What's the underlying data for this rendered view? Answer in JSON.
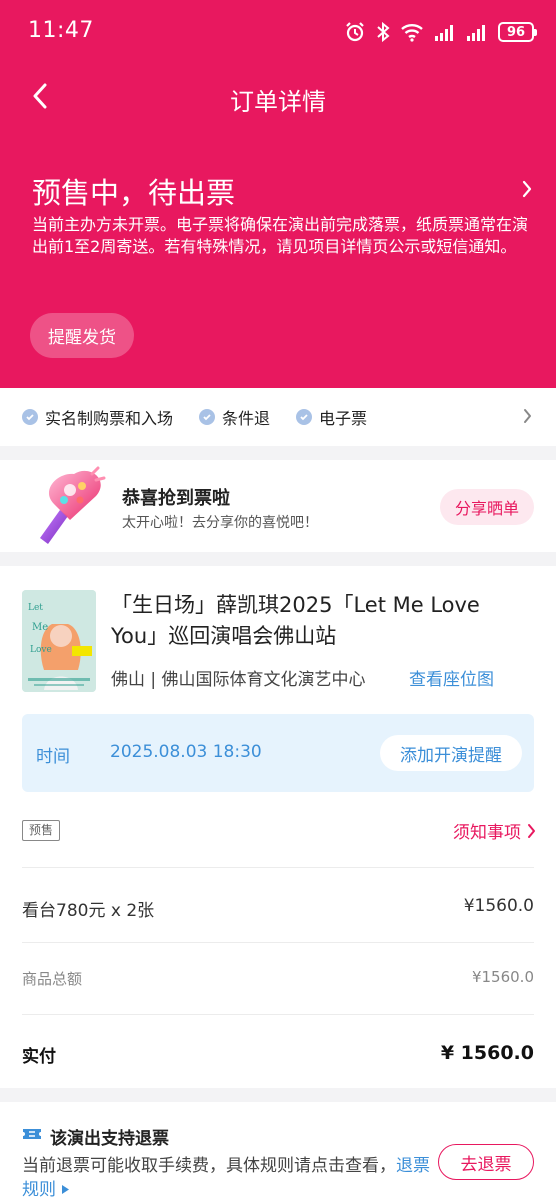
{
  "statusbar": {
    "time": "11:47",
    "battery": "96"
  },
  "nav": {
    "title": "订单详情"
  },
  "order_status": {
    "title": "预售中，待出票",
    "description": "当前主办方未开票。电子票将确保在演出前完成落票，纸质票通常在演出前1至2周寄送。若有特殊情况，请见项目详情页公示或短信通知。",
    "remind_button": "提醒发货"
  },
  "tags": [
    {
      "label": "实名制购票和入场"
    },
    {
      "label": "条件退"
    },
    {
      "label": "电子票"
    }
  ],
  "congrats": {
    "title": "恭喜抢到票啦",
    "subtitle": "太开心啦！去分享你的喜悦吧！",
    "share_button": "分享晒单"
  },
  "show": {
    "title": "「生日场」薛凯琪2025「Let Me Love You」巡回演唱会佛山站",
    "venue": "佛山 | 佛山国际体育文化演艺中心",
    "seat_map_link": "查看座位图",
    "time_label": "时间",
    "time_value": "2025.08.03 18:30",
    "add_reminder": "添加开演提醒",
    "presale_badge": "预售",
    "notice_link": "须知事项"
  },
  "pricing": {
    "item_label": "看台780元 x 2张",
    "item_amount": "¥1560.0",
    "subtotal_label": "商品总额",
    "subtotal_amount": "¥1560.0",
    "paid_label": "实付",
    "paid_amount": "¥ 1560.0"
  },
  "refund": {
    "title": "该演出支持退票",
    "description": "当前退票可能收取手续费，具体规则请点击查看，",
    "rules_link": "退票规则",
    "button": "去退票"
  },
  "colors": {
    "brand": "#e8185f",
    "link": "#3c8fd8"
  }
}
